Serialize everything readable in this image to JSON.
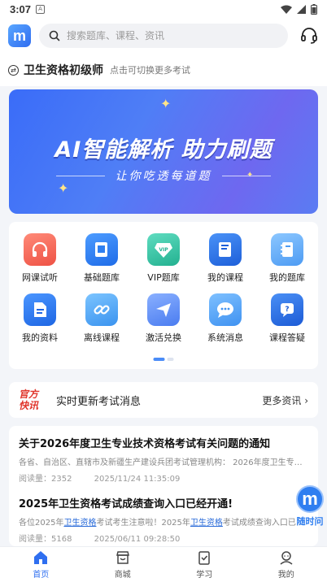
{
  "status": {
    "time": "3:07",
    "notif": "A"
  },
  "header": {
    "logo_letter": "m",
    "search_placeholder": "搜索题库、课程、资讯"
  },
  "exam": {
    "name": "卫生资格初级师",
    "hint": "点击可切换更多考试"
  },
  "banner": {
    "title": "AI智能解析 助力刷题",
    "subtitle": "让你吃透每道题"
  },
  "grid": [
    {
      "label": "网课试听",
      "icon": "headphones-icon",
      "color": "#f0655a"
    },
    {
      "label": "基础题库",
      "icon": "book-icon",
      "color": "#2f7ff0"
    },
    {
      "label": "VIP题库",
      "icon": "vip-diamond-icon",
      "color": "#34c6a6"
    },
    {
      "label": "我的课程",
      "icon": "course-book-icon",
      "color": "#2b73ee"
    },
    {
      "label": "我的题库",
      "icon": "notebook-icon",
      "color": "#4ea4f5"
    },
    {
      "label": "我的资料",
      "icon": "document-icon",
      "color": "#2d7cf0"
    },
    {
      "label": "离线课程",
      "icon": "offline-link-icon",
      "color": "#4aa7f3"
    },
    {
      "label": "激活兑换",
      "icon": "send-plane-icon",
      "color": "#5b8ef5"
    },
    {
      "label": "系统消息",
      "icon": "chat-bubble-icon",
      "color": "#3f9df5"
    },
    {
      "label": "课程答疑",
      "icon": "qa-icon",
      "color": "#2e6fe8"
    }
  ],
  "news": {
    "badge_line1": "官方",
    "badge_line2": "快讯",
    "text": "实时更新考试消息",
    "more": "更多资讯 ›"
  },
  "articles": [
    {
      "title": "关于2026年度卫生专业技术资格考试有关问题的通知",
      "desc": "各省、自治区、直辖市及新疆生产建设兵团考试管理机构： 2026年度卫生专业技术资格考试...",
      "reads_label": "阅读量：",
      "reads": "2352",
      "date": "2025/11/24 11:35:09"
    },
    {
      "title": "2025年卫生资格考试成绩查询入口已经开通!",
      "desc_pre": "各位2025年",
      "desc_hl1": "卫生资格",
      "desc_mid": "考试考生注意啦！2025年",
      "desc_hl2": "卫生资格",
      "desc_post": "考试成绩查询入口已经开通",
      "reads_label": "阅读量：",
      "reads": "5168",
      "date": "2025/06/11 09:28:50"
    }
  ],
  "float": {
    "label": "随时问",
    "letter": "m"
  },
  "tabs": [
    {
      "label": "首页",
      "icon": "home-icon",
      "active": true
    },
    {
      "label": "商城",
      "icon": "shop-icon",
      "active": false
    },
    {
      "label": "学习",
      "icon": "study-icon",
      "active": false
    },
    {
      "label": "我的",
      "icon": "profile-icon",
      "active": false
    }
  ],
  "colors": {
    "accent": "#2f6ff0",
    "badge_red": "#e0352b",
    "link": "#2a6bd9"
  }
}
